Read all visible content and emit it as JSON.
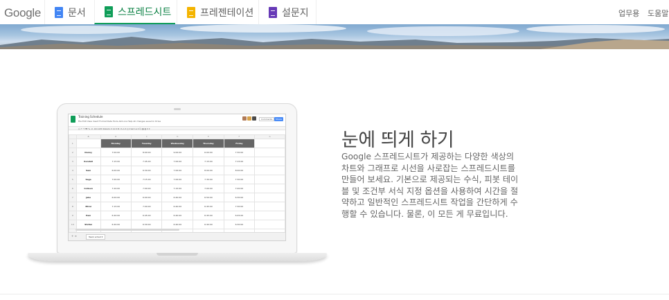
{
  "brand": {
    "logo_text": "Google"
  },
  "nav": {
    "tabs": [
      {
        "label": "문서",
        "color": "#4285f4",
        "active": false
      },
      {
        "label": "스프레드시트",
        "color": "#0f9d58",
        "active": true
      },
      {
        "label": "프레젠테이션",
        "color": "#f4b400",
        "active": false
      },
      {
        "label": "설문지",
        "color": "#673ab7",
        "active": false
      }
    ],
    "links": [
      "업무용",
      "도움말"
    ]
  },
  "hero": {
    "headline": "눈에 띄게 하기",
    "description": "Google 스프레드시트가 제공하는 다양한 색상의 차트와 그래프로 시선을 사로잡는 스프레드시트를 만들어 보세요. 기본으로 제공되는 수식, 피봇 테이블 및 조건부 서식 지정 옵션을 사용하여 시간을 절약하고 일반적인 스프레드시트 작업을 간단하게 수행할 수 있습니다. 물론, 이 모든 게 무료입니다."
  },
  "sheet": {
    "title": "Training Schedule",
    "menu": "File  Edit  View  Insert  Format  Data  Tools  Add-ons  Help   All changes saved in Drive",
    "toolbar": "⎙  ↶  ↷  ₩  %  .0  .00  123▾   Roboto ▾   10 ▾   B  I  S  A ▾   ◫ ▾  ⊞ ▾  ≡ ▾   ⎘  ◨  ▥  Σ ▾",
    "comments_label": "Comments",
    "share_label": "Share",
    "columns": [
      "A",
      "B",
      "C",
      "D",
      "E",
      "F",
      "G"
    ],
    "days": [
      "Monday",
      "Tuesday",
      "Wednesday",
      "Thursday",
      "Friday"
    ],
    "rows": [
      {
        "num": "1",
        "name": "",
        "values": [
          "",
          "",
          "",
          "",
          ""
        ]
      },
      {
        "num": "2",
        "name": "Danny",
        "values": [
          "7:00:00",
          "8:00:00",
          "9:00:00",
          "6:00:00",
          "7:30:00"
        ]
      },
      {
        "num": "3",
        "name": "Kendall",
        "values": [
          "7:15:00",
          "7:45:00",
          "7:00:00",
          "7:15:00",
          "7:15:00"
        ]
      },
      {
        "num": "4",
        "name": "Sam",
        "values": [
          "6:00:00",
          "6:30:00",
          "7:00:00",
          "8:00:00",
          "8:00:00"
        ]
      },
      {
        "num": "5",
        "name": "Sage",
        "values": [
          "7:00:00",
          "7:15:00",
          "7:00:00",
          "7:30:00",
          "7:30:00"
        ]
      },
      {
        "num": "6",
        "name": "Colleen",
        "values": [
          "7:20:00",
          "7:00:00",
          "7:15:00",
          "7:00:00",
          "7:00:00"
        ]
      },
      {
        "num": "7",
        "name": "Jake",
        "values": [
          "6:00:00",
          "6:00:00",
          "6:40:00",
          "6:50:00",
          "6:30:00"
        ]
      },
      {
        "num": "8",
        "name": "Mirai",
        "values": [
          "7:15:00",
          "7:00:00",
          "6:40:00",
          "6:45:00",
          "7:30:00"
        ]
      },
      {
        "num": "9",
        "name": "Pam",
        "values": [
          "6:40:00",
          "6:45:00",
          "6:40:00",
          "6:45:00",
          "6:45:00"
        ]
      },
      {
        "num": "10",
        "name": "Stefan",
        "values": [
          "6:40:00",
          "6:30:00",
          "6:40:00",
          "6:40:00",
          "6:30:00"
        ]
      },
      {
        "num": "11",
        "name": "June",
        "values": [
          "6:30:00",
          "6:30:00",
          "6:20:00",
          "6:10:00",
          "6:30:00"
        ]
      }
    ],
    "sheet_tab": "Team sched ▾"
  }
}
